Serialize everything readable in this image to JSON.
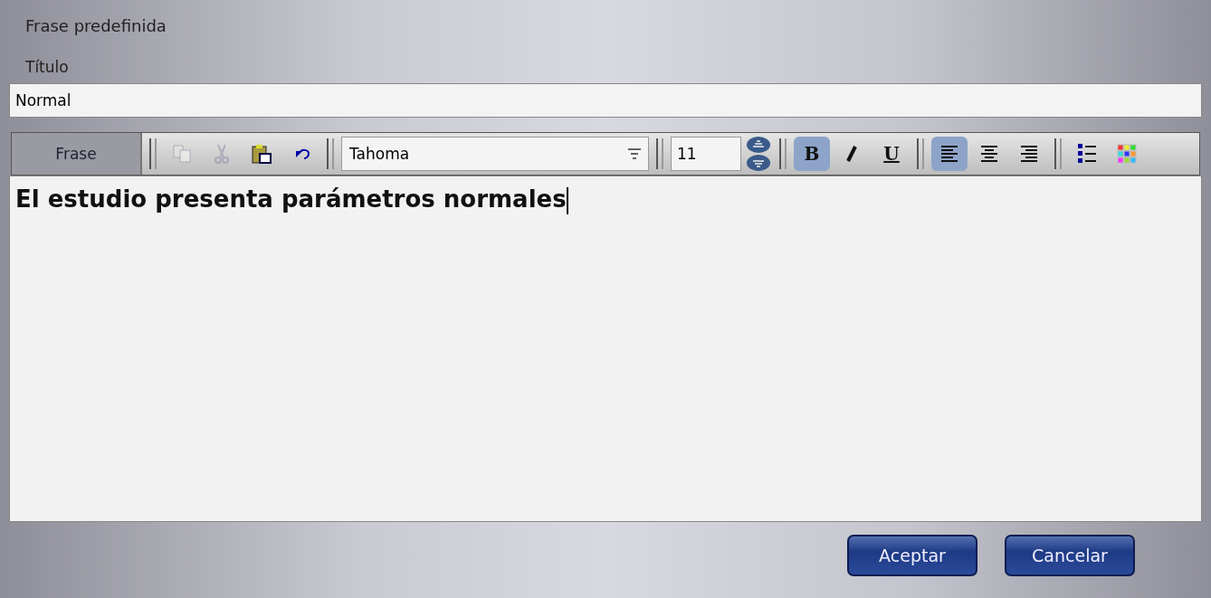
{
  "window": {
    "title": "Frase predefinida"
  },
  "title_field": {
    "label": "Título",
    "value": "Normal"
  },
  "toolbar": {
    "tab": {
      "label": "Frase",
      "selected": true
    },
    "edit_buttons": [
      {
        "kind": "copy",
        "disabled": true
      },
      {
        "kind": "cut",
        "disabled": true
      },
      {
        "kind": "paste",
        "disabled": false
      },
      {
        "kind": "undo",
        "disabled": false
      }
    ],
    "font": {
      "value": "Tahoma"
    },
    "size": {
      "value": "11"
    },
    "format_buttons": [
      {
        "kind": "bold",
        "label": "B",
        "selected": true
      },
      {
        "kind": "italic",
        "selected": false
      },
      {
        "kind": "underline",
        "label": "U",
        "selected": false
      }
    ],
    "align_buttons": [
      {
        "kind": "left",
        "selected": true
      },
      {
        "kind": "center",
        "selected": false
      },
      {
        "kind": "right",
        "selected": false
      }
    ],
    "extra_buttons": [
      {
        "kind": "list"
      },
      {
        "kind": "colors"
      }
    ]
  },
  "editor": {
    "text": "El estudio presenta parámetros normales",
    "bold": true
  },
  "buttons": [
    {
      "label": "Aceptar"
    },
    {
      "label": "Cancelar"
    }
  ]
}
